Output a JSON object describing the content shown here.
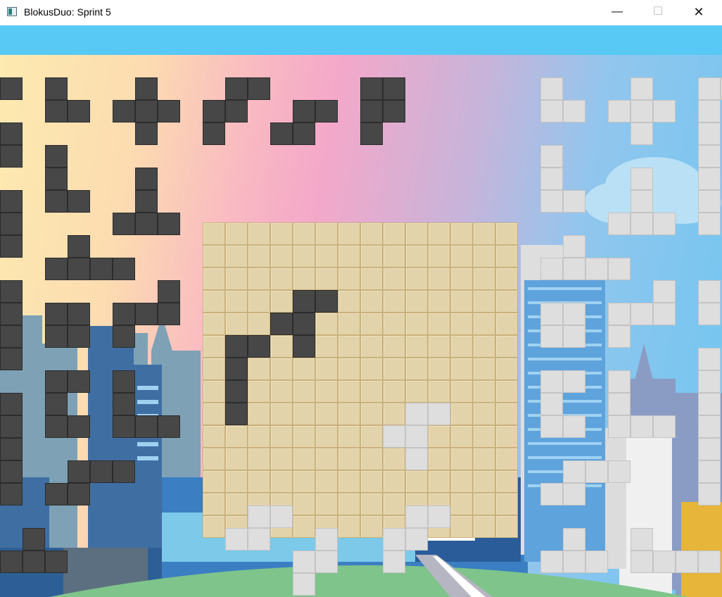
{
  "window": {
    "title": "BlokusDuo: Sprint 5"
  },
  "window_controls": {
    "minimize_glyph": "—",
    "maximize_glyph": "☐",
    "close_glyph": "✕"
  },
  "colors": {
    "title_bar": "#ffffff",
    "top_bar": "#57c9f4",
    "board_empty": "#e2d3aa",
    "dark_player": "#474747",
    "light_player": "#dedede"
  },
  "board": {
    "size": 14,
    "dark_cells": [
      [
        4,
        3
      ],
      [
        5,
        3
      ],
      [
        3,
        4
      ],
      [
        4,
        4
      ],
      [
        1,
        5
      ],
      [
        2,
        5
      ],
      [
        4,
        5
      ],
      [
        1,
        6
      ],
      [
        1,
        7
      ],
      [
        1,
        8
      ]
    ],
    "light_cells": [
      [
        9,
        8
      ],
      [
        10,
        8
      ],
      [
        8,
        9
      ],
      [
        9,
        9
      ],
      [
        9,
        10
      ]
    ]
  },
  "dark_tray": [
    {
      "id": "d1",
      "cells": [
        [
          0,
          0
        ]
      ]
    },
    {
      "id": "d2",
      "cells": [
        [
          0,
          0
        ],
        [
          0,
          1
        ],
        [
          1,
          1
        ]
      ]
    },
    {
      "id": "d3",
      "cells": [
        [
          1,
          0
        ],
        [
          0,
          1
        ],
        [
          1,
          1
        ],
        [
          2,
          1
        ],
        [
          1,
          2
        ]
      ]
    },
    {
      "id": "d4",
      "cells": [
        [
          1,
          0
        ],
        [
          2,
          0
        ],
        [
          0,
          1
        ],
        [
          1,
          1
        ],
        [
          0,
          2
        ]
      ]
    },
    {
      "id": "d5",
      "cells": [
        [
          1,
          0
        ],
        [
          2,
          0
        ],
        [
          0,
          1
        ],
        [
          1,
          1
        ]
      ]
    },
    {
      "id": "d6",
      "cells": [
        [
          0,
          0
        ],
        [
          1,
          0
        ],
        [
          0,
          1
        ],
        [
          1,
          1
        ],
        [
          0,
          2
        ]
      ]
    },
    {
      "id": "d7",
      "cells": [
        [
          0,
          0
        ],
        [
          0,
          1
        ]
      ]
    },
    {
      "id": "d8",
      "cells": [
        [
          0,
          0
        ],
        [
          0,
          1
        ],
        [
          0,
          2
        ],
        [
          1,
          2
        ]
      ]
    },
    {
      "id": "d9",
      "cells": [
        [
          1,
          0
        ],
        [
          1,
          1
        ],
        [
          0,
          2
        ],
        [
          1,
          2
        ],
        [
          2,
          2
        ]
      ]
    },
    {
      "id": "d10",
      "cells": [
        [
          0,
          0
        ],
        [
          0,
          1
        ],
        [
          0,
          2
        ]
      ]
    },
    {
      "id": "d11",
      "cells": [
        [
          1,
          0
        ],
        [
          0,
          1
        ],
        [
          1,
          1
        ],
        [
          2,
          1
        ],
        [
          3,
          1
        ]
      ]
    },
    {
      "id": "d12",
      "cells": [
        [
          0,
          0
        ],
        [
          0,
          1
        ],
        [
          0,
          2
        ],
        [
          0,
          3
        ]
      ]
    },
    {
      "id": "d13",
      "cells": [
        [
          0,
          0
        ],
        [
          1,
          0
        ],
        [
          0,
          1
        ],
        [
          1,
          1
        ]
      ]
    },
    {
      "id": "d14",
      "cells": [
        [
          2,
          0
        ],
        [
          0,
          1
        ],
        [
          1,
          1
        ],
        [
          2,
          1
        ],
        [
          0,
          2
        ]
      ]
    },
    {
      "id": "d15",
      "cells": [
        [
          0,
          0
        ],
        [
          1,
          0
        ],
        [
          0,
          1
        ],
        [
          0,
          2
        ],
        [
          1,
          2
        ]
      ]
    },
    {
      "id": "d16",
      "cells": [
        [
          0,
          0
        ],
        [
          0,
          1
        ],
        [
          0,
          2
        ],
        [
          1,
          2
        ],
        [
          2,
          2
        ]
      ]
    },
    {
      "id": "d17",
      "cells": [
        [
          0,
          0
        ],
        [
          0,
          1
        ],
        [
          0,
          2
        ],
        [
          0,
          3
        ],
        [
          0,
          4
        ]
      ]
    },
    {
      "id": "d18",
      "cells": [
        [
          1,
          0
        ],
        [
          2,
          0
        ],
        [
          3,
          0
        ],
        [
          0,
          1
        ],
        [
          1,
          1
        ]
      ]
    },
    {
      "id": "d19",
      "cells": [
        [
          1,
          0
        ],
        [
          0,
          1
        ],
        [
          1,
          1
        ],
        [
          2,
          1
        ]
      ]
    }
  ],
  "light_tray": [
    {
      "id": "l1",
      "cells": [
        [
          0,
          0
        ],
        [
          0,
          1
        ],
        [
          1,
          1
        ]
      ]
    },
    {
      "id": "l2",
      "cells": [
        [
          1,
          0
        ],
        [
          0,
          1
        ],
        [
          1,
          1
        ],
        [
          2,
          1
        ],
        [
          1,
          2
        ]
      ]
    },
    {
      "id": "l3",
      "cells": [
        [
          0,
          0
        ],
        [
          0,
          1
        ],
        [
          0,
          2
        ]
      ]
    },
    {
      "id": "l4",
      "cells": [
        [
          0,
          0
        ],
        [
          0,
          1
        ],
        [
          0,
          2
        ],
        [
          1,
          2
        ]
      ]
    },
    {
      "id": "l5",
      "cells": [
        [
          1,
          0
        ],
        [
          1,
          1
        ],
        [
          0,
          2
        ],
        [
          1,
          2
        ],
        [
          2,
          2
        ]
      ]
    },
    {
      "id": "l6",
      "cells": [
        [
          0,
          0
        ],
        [
          0,
          1
        ]
      ]
    },
    {
      "id": "l7",
      "cells": [
        [
          1,
          0
        ],
        [
          0,
          1
        ],
        [
          1,
          1
        ],
        [
          2,
          1
        ],
        [
          3,
          1
        ]
      ]
    },
    {
      "id": "l8",
      "cells": [
        [
          0,
          0
        ],
        [
          0,
          1
        ]
      ]
    },
    {
      "id": "l9",
      "cells": [
        [
          0,
          0
        ],
        [
          1,
          0
        ],
        [
          0,
          1
        ],
        [
          1,
          1
        ]
      ]
    },
    {
      "id": "l10",
      "cells": [
        [
          2,
          0
        ],
        [
          0,
          1
        ],
        [
          1,
          1
        ],
        [
          2,
          1
        ],
        [
          0,
          2
        ]
      ]
    },
    {
      "id": "l11",
      "cells": [
        [
          0,
          0
        ],
        [
          0,
          1
        ]
      ]
    },
    {
      "id": "l12",
      "cells": [
        [
          0,
          0
        ],
        [
          1,
          0
        ],
        [
          0,
          1
        ],
        [
          0,
          2
        ],
        [
          1,
          2
        ]
      ]
    },
    {
      "id": "l13",
      "cells": [
        [
          0,
          0
        ],
        [
          0,
          1
        ],
        [
          0,
          2
        ],
        [
          1,
          2
        ],
        [
          2,
          2
        ]
      ]
    },
    {
      "id": "l14",
      "cells": [
        [
          0,
          0
        ],
        [
          0,
          1
        ],
        [
          0,
          2
        ],
        [
          0,
          3
        ],
        [
          0,
          4
        ]
      ]
    },
    {
      "id": "l15",
      "cells": [
        [
          1,
          0
        ],
        [
          2,
          0
        ],
        [
          3,
          0
        ],
        [
          0,
          1
        ],
        [
          1,
          1
        ]
      ]
    },
    {
      "id": "l16",
      "cells": [
        [
          1,
          0
        ],
        [
          2,
          0
        ],
        [
          0,
          1
        ],
        [
          1,
          1
        ]
      ]
    },
    {
      "id": "l17",
      "cells": [
        [
          1,
          0
        ],
        [
          2,
          0
        ],
        [
          0,
          1
        ],
        [
          1,
          1
        ],
        [
          0,
          2
        ]
      ]
    },
    {
      "id": "l18",
      "cells": [
        [
          1,
          0
        ],
        [
          0,
          1
        ],
        [
          1,
          1
        ],
        [
          0,
          2
        ]
      ]
    },
    {
      "id": "l19",
      "cells": [
        [
          0,
          0
        ],
        [
          1,
          0
        ],
        [
          0,
          1
        ],
        [
          0,
          2
        ]
      ]
    },
    {
      "id": "l20",
      "cells": [
        [
          1,
          0
        ],
        [
          0,
          1
        ],
        [
          1,
          1
        ],
        [
          2,
          1
        ]
      ]
    },
    {
      "id": "l21",
      "cells": [
        [
          0,
          0
        ],
        [
          0,
          1
        ],
        [
          1,
          1
        ],
        [
          2,
          1
        ],
        [
          3,
          1
        ]
      ]
    }
  ]
}
